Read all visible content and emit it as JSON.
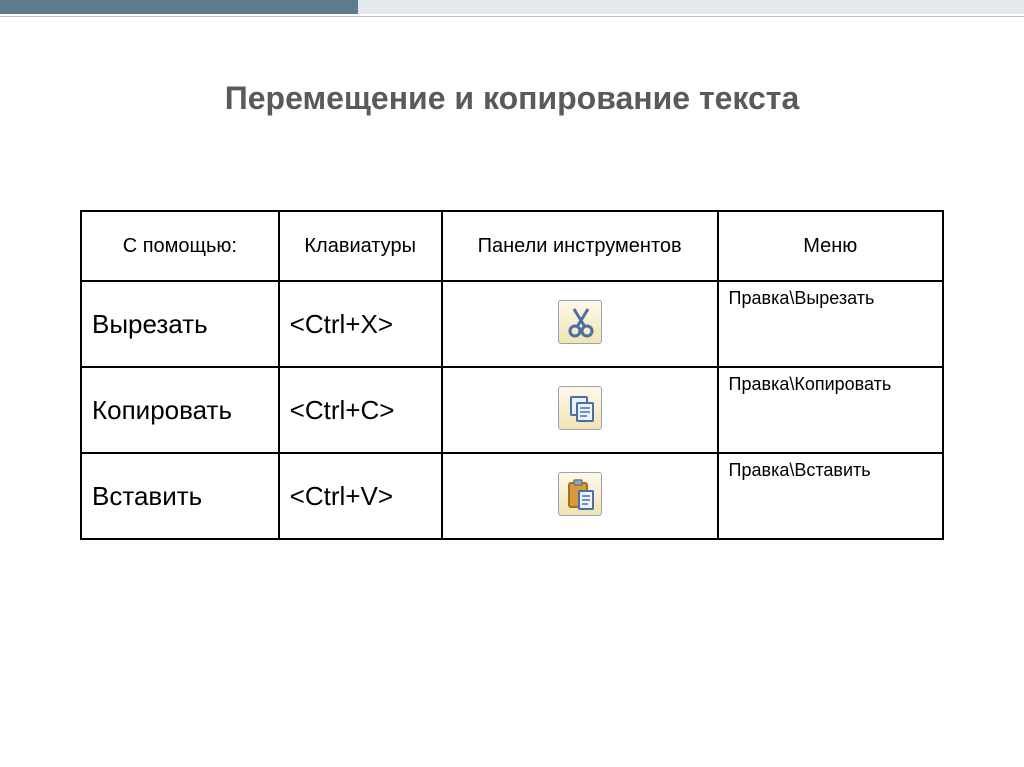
{
  "title": "Перемещение и копирование текста",
  "headers": {
    "with": "С помощью:",
    "keyboard": "Клавиатуры",
    "toolbar": "Панели инструментов",
    "menu": "Меню"
  },
  "rows": [
    {
      "action": "Вырезать",
      "shortcut": "<Ctrl+X>",
      "icon": "scissors-icon",
      "menu": "Правка\\Вырезать"
    },
    {
      "action": "Копировать",
      "shortcut": "<Ctrl+C>",
      "icon": "copy-icon",
      "menu": "Правка\\Копировать"
    },
    {
      "action": "Вставить",
      "shortcut": "<Ctrl+V>",
      "icon": "paste-icon",
      "menu": "Правка\\Вставить"
    }
  ]
}
